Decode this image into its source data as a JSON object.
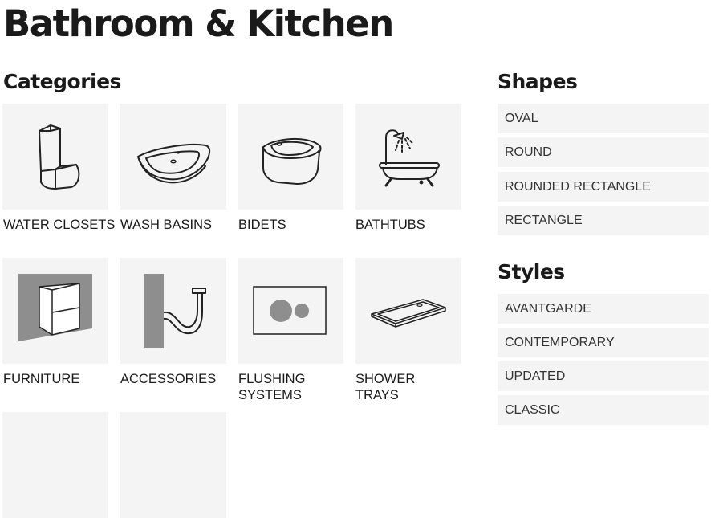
{
  "page": {
    "title": "Bathroom & Kitchen"
  },
  "categories": {
    "heading": "Categories",
    "items": [
      {
        "label": "WATER CLOSETS",
        "icon": "water-closet-icon"
      },
      {
        "label": "WASH BASINS",
        "icon": "wash-basin-icon"
      },
      {
        "label": "BIDETS",
        "icon": "bidet-icon"
      },
      {
        "label": "BATHTUBS",
        "icon": "bathtub-icon"
      },
      {
        "label": "FURNITURE",
        "icon": "furniture-cabinet-icon"
      },
      {
        "label": "ACCESSORIES",
        "icon": "accessories-pipe-icon"
      },
      {
        "label": "FLUSHING SYSTEMS",
        "icon": "flush-plate-icon"
      },
      {
        "label": "SHOWER TRAYS",
        "icon": "shower-tray-icon"
      }
    ]
  },
  "shapes": {
    "heading": "Shapes",
    "items": [
      "OVAL",
      "ROUND",
      "ROUNDED RECTANGLE",
      "RECTANGLE"
    ]
  },
  "styles": {
    "heading": "Styles",
    "items": [
      "AVANTGARDE",
      "CONTEMPORARY",
      "UPDATED",
      "CLASSIC"
    ]
  },
  "colors": {
    "tile_background": "#f4f4f4",
    "text": "#1a1a1a",
    "icon_stroke": "#222222"
  }
}
